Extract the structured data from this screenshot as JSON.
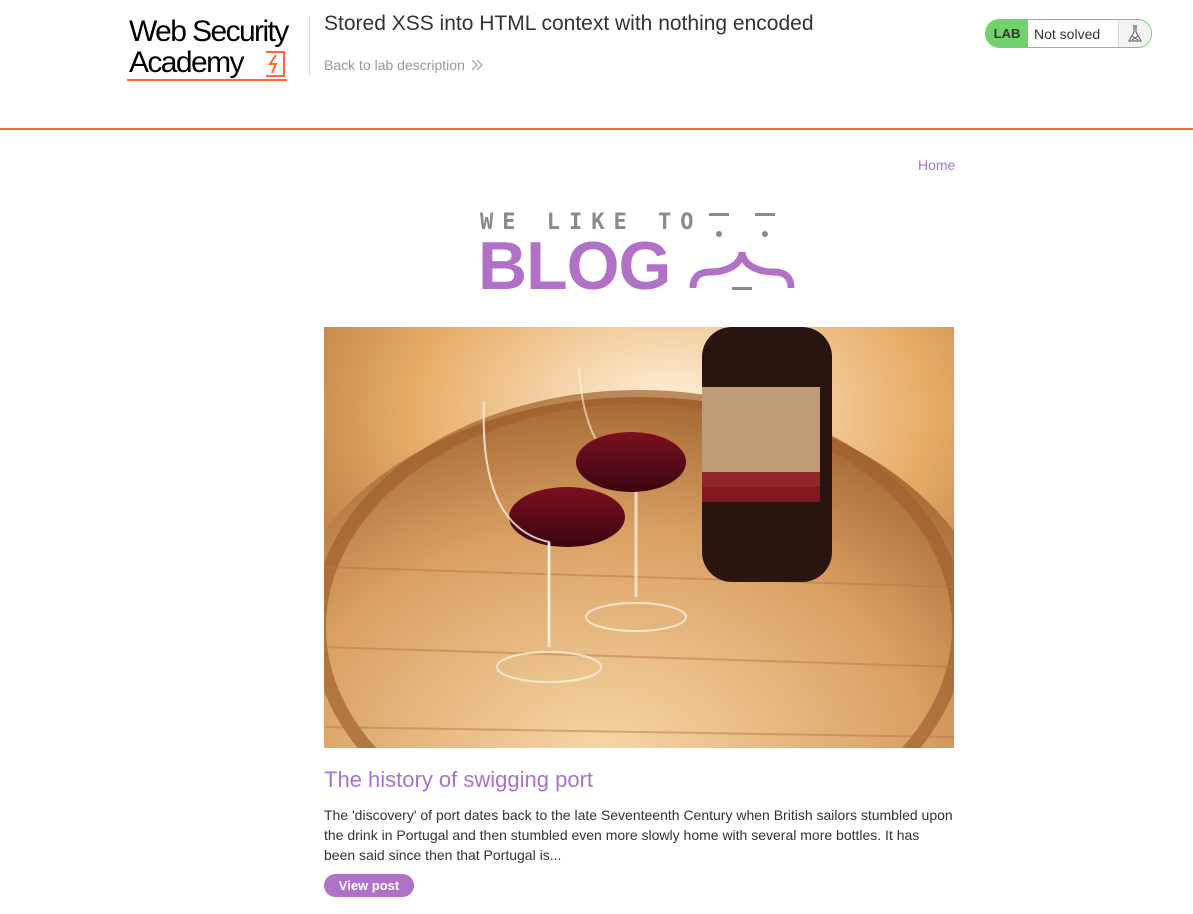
{
  "academy": {
    "logo_line1": "Web Security",
    "logo_line2": "Academy",
    "lab_title": "Stored XSS into HTML context with nothing encoded",
    "back_link": "Back to lab description",
    "status_badge": "LAB",
    "status_text": "Not solved",
    "status_icon": "flask-icon"
  },
  "nav": {
    "home": "Home"
  },
  "banner": {
    "small_text": "WE LIKE TO",
    "big_text": "BLOG"
  },
  "post": {
    "image_icon": "wine-glasses-and-bottle-on-barrel-photo",
    "title": "The history of swigging port",
    "summary": "The 'discovery' of port dates back to the late Seventeenth Century when British sailors stumbled upon the drink in Portugal and then stumbled even more slowly home with several more bottles. It has been said since then that Portugal is...",
    "button": "View post"
  },
  "colors": {
    "accent_orange": "#ff6633",
    "lab_green": "#70d16d",
    "blog_purple": "#b071c6",
    "link_purple": "#a873c8"
  }
}
